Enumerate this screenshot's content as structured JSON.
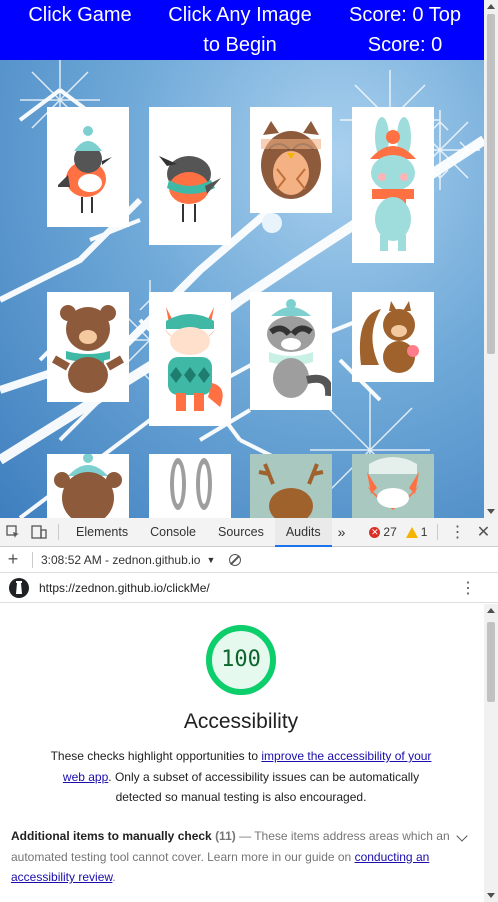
{
  "game": {
    "title": "Click Game",
    "instructions": "Click Any Image to Begin",
    "score": "Score: 0 Top Score: 0",
    "cards": [
      {
        "name": "robin-bird-card",
        "animal": "robin bird with hat",
        "accent": "#ff7043"
      },
      {
        "name": "robin-bird-2-card",
        "animal": "robin bird with scarf",
        "accent": "#ff7043"
      },
      {
        "name": "owl-card",
        "animal": "owl",
        "accent": "#8d5a3b"
      },
      {
        "name": "bunny-card",
        "animal": "bunny",
        "accent": "#7ecfd0"
      },
      {
        "name": "bear-card",
        "animal": "brown bear",
        "accent": "#8d5a3b"
      },
      {
        "name": "fox-card",
        "animal": "fox with sweater",
        "accent": "#ff7043"
      },
      {
        "name": "raccoon-card",
        "animal": "raccoon",
        "accent": "#9e9e9e"
      },
      {
        "name": "squirrel-card",
        "animal": "squirrel",
        "accent": "#a0622d"
      },
      {
        "name": "bear-2-card",
        "animal": "bear with hat",
        "accent": "#8d5a3b"
      },
      {
        "name": "rabbit-card",
        "animal": "grey rabbit",
        "accent": "#9e9e9e"
      },
      {
        "name": "reindeer-card",
        "animal": "reindeer",
        "accent": "#a0622d"
      },
      {
        "name": "fox-2-card",
        "animal": "fox face",
        "accent": "#ff7043"
      }
    ],
    "colors": {
      "header_bg": "#0000ff",
      "header_text": "#ffffff"
    }
  },
  "devtools": {
    "tabs": [
      "Elements",
      "Console",
      "Sources",
      "Audits"
    ],
    "active_tab": "Audits",
    "more_tabs": "»",
    "error_count": "27",
    "warning_count": "1",
    "run_label": "3:08:52 AM - zednon.github.io",
    "url": "https://zednon.github.io/clickMe/",
    "icons": [
      "inspect-icon",
      "device-toggle-icon",
      "kebab-icon",
      "close-icon",
      "plus-icon",
      "dropdown-icon",
      "clear-icon",
      "lighthouse-icon"
    ]
  },
  "report": {
    "score": "100",
    "score_fraction": 1.0,
    "score_color": "#0cce6b",
    "category": "Accessibility",
    "desc_pre": "These checks highlight opportunities to ",
    "desc_link": "improve the accessibility of your web app",
    "desc_post": ". Only a subset of accessibility issues can be automatically detected so manual testing is also encouraged.",
    "manual_head": "Additional items to manually check",
    "manual_count": "(11)",
    "manual_dash": " — ",
    "manual_text": "These items address areas which an automated testing tool cannot cover. Learn more in our guide on ",
    "manual_link": "conducting an accessibility review",
    "manual_end": "."
  }
}
